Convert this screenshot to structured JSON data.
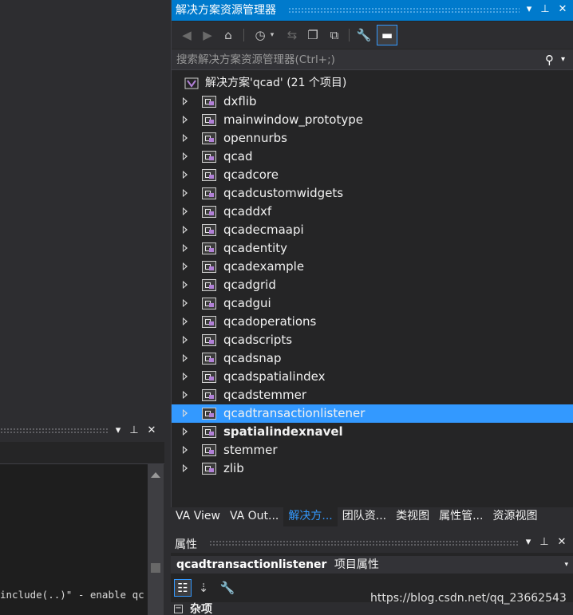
{
  "solution_explorer": {
    "title": "解决方案资源管理器",
    "search_placeholder": "搜索解决方案资源管理器(Ctrl+;)",
    "root_label": "解决方案'qcad' (21 个项目)",
    "projects": [
      {
        "name": "dxflib"
      },
      {
        "name": "mainwindow_prototype"
      },
      {
        "name": "opennurbs"
      },
      {
        "name": "qcad"
      },
      {
        "name": "qcadcore"
      },
      {
        "name": "qcadcustomwidgets"
      },
      {
        "name": "qcaddxf"
      },
      {
        "name": "qcadecmaapi"
      },
      {
        "name": "qcadentity"
      },
      {
        "name": "qcadexample"
      },
      {
        "name": "qcadgrid"
      },
      {
        "name": "qcadgui"
      },
      {
        "name": "qcadoperations"
      },
      {
        "name": "qcadscripts"
      },
      {
        "name": "qcadsnap"
      },
      {
        "name": "qcadspatialindex"
      },
      {
        "name": "qcadstemmer"
      },
      {
        "name": "qcadtransactionlistener",
        "selected": true
      },
      {
        "name": "spatialindexnavel",
        "bold": true
      },
      {
        "name": "stemmer"
      },
      {
        "name": "zlib"
      }
    ],
    "toolbar_icons": [
      "back-icon",
      "forward-icon",
      "home-icon",
      "history-icon",
      "sync-icon",
      "collapse-all-icon",
      "show-all-files-icon",
      "properties-wrench-icon",
      "preview-pin-icon"
    ]
  },
  "tabs": [
    "VA View",
    "VA Out...",
    "解决方...",
    "团队资...",
    "类视图",
    "属性管...",
    "资源视图"
  ],
  "active_tab": "解决方...",
  "properties": {
    "title": "属性",
    "object_name": "qcadtransactionlistener",
    "object_kind": "项目属性",
    "category": "杂项"
  },
  "output": {
    "text": "include(..)\" - enable qc"
  },
  "watermark": "https://blog.csdn.net/qq_23662543",
  "colors": {
    "accent": "#007acc",
    "selection": "#3399ff",
    "panel": "#252526",
    "chrome": "#2d2d30"
  }
}
